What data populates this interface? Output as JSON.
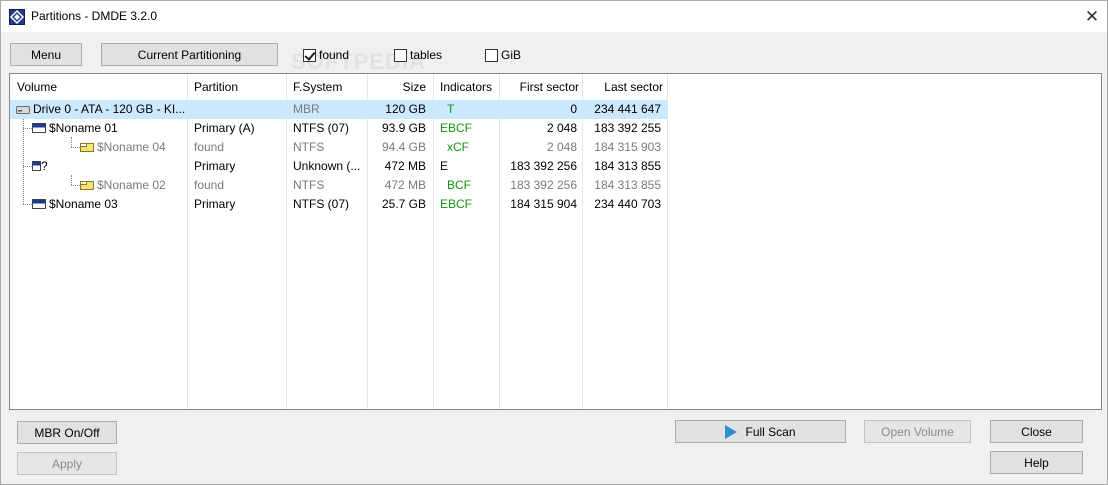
{
  "window": {
    "title": "Partitions - DMDE 3.2.0",
    "close_glyph": "✕"
  },
  "toolbar": {
    "menu_label": "Menu",
    "current_partitioning_label": "Current Partitioning",
    "found_label": "found",
    "found_checked": true,
    "tables_label": "tables",
    "tables_checked": false,
    "gib_label": "GiB",
    "gib_checked": false
  },
  "watermark": "SOFTPEDIA",
  "columns": {
    "volume": "Volume",
    "partition": "Partition",
    "fs": "F.System",
    "size": "Size",
    "indicators": "Indicators",
    "first": "First sector",
    "last": "Last sector"
  },
  "rows": [
    {
      "volume": "Drive 0 - ATA - 120 GB - KI...",
      "partition": "",
      "fs": "MBR",
      "size": "120 GB",
      "ind": "T",
      "first": "0",
      "last": "234 441 647",
      "icon": "drive-icon"
    },
    {
      "volume": "$Noname 01",
      "partition": "Primary (A)",
      "fs": "NTFS (07)",
      "size": "93.9 GB",
      "ind": "EBCF",
      "first": "2 048",
      "last": "183 392 255",
      "icon": "partition-icon"
    },
    {
      "volume": "$Noname 04",
      "partition": "found",
      "fs": "NTFS",
      "size": "94.4 GB",
      "ind": "xCF",
      "first": "2 048",
      "last": "184 315 903",
      "icon": "found-volume-icon"
    },
    {
      "volume": "?",
      "partition": "Primary",
      "fs": "Unknown (...",
      "size": "472 MB",
      "ind": "E",
      "first": "183 392 256",
      "last": "184 313 855",
      "icon": "unknown-partition-icon"
    },
    {
      "volume": "$Noname 02",
      "partition": "found",
      "fs": "NTFS",
      "size": "472 MB",
      "ind": "BCF",
      "first": "183 392 256",
      "last": "184 313 855",
      "icon": "found-volume-icon"
    },
    {
      "volume": "$Noname 03",
      "partition": "Primary",
      "fs": "NTFS (07)",
      "size": "25.7 GB",
      "ind": "EBCF",
      "first": "184 315 904",
      "last": "234 440 703",
      "icon": "partition-icon"
    }
  ],
  "buttons": {
    "mbr_onoff": "MBR On/Off",
    "apply": "Apply",
    "full_scan": "Full Scan",
    "open_volume": "Open Volume",
    "close": "Close",
    "help": "Help"
  },
  "colors": {
    "selection": "#cce8ff",
    "indicator_green": "#109610",
    "found_gray": "#7a7a7a",
    "accent": "#2b8fd6"
  }
}
